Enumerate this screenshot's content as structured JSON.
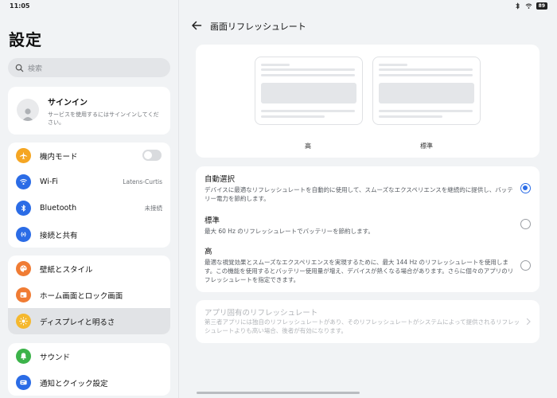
{
  "status_bar": {
    "time": "11:05",
    "battery": "89"
  },
  "left_panel": {
    "title": "設定",
    "search_placeholder": "検索",
    "signin": {
      "title": "サインイン",
      "subtitle": "サービスを使用するにはサインインしてください。"
    },
    "groups": [
      [
        {
          "label": "機内モード",
          "icon": "airplane-icon",
          "color": "#f5a623",
          "toggle": false
        },
        {
          "label": "Wi-Fi",
          "icon": "wifi-icon",
          "color": "#2b6ce6",
          "value": "Latens-Curtis"
        },
        {
          "label": "Bluetooth",
          "icon": "bluetooth-icon",
          "color": "#2b6ce6",
          "value": "未接続"
        },
        {
          "label": "接続と共有",
          "icon": "connection-icon",
          "color": "#2b6ce6"
        }
      ],
      [
        {
          "label": "壁紙とスタイル",
          "icon": "palette-icon",
          "color": "#f07c34"
        },
        {
          "label": "ホーム画面とロック画面",
          "icon": "home-screen-icon",
          "color": "#f07c34"
        },
        {
          "label": "ディスプレイと明るさ",
          "icon": "brightness-icon",
          "color": "#f5b82e",
          "selected": true
        }
      ],
      [
        {
          "label": "サウンド",
          "icon": "bell-icon",
          "color": "#3cb34a"
        },
        {
          "label": "通知とクイック設定",
          "icon": "notification-icon",
          "color": "#2b6ce6"
        }
      ]
    ]
  },
  "right_panel": {
    "title": "画面リフレッシュレート",
    "preview": {
      "high_label": "高",
      "standard_label": "標準"
    },
    "options": [
      {
        "title": "自動選択",
        "desc": "デバイスに最適なリフレッシュレートを自動的に使用して、スムーズなエクスペリエンスを継続的に提供し、バッテリー電力を節約します。",
        "selected": true
      },
      {
        "title": "標準",
        "desc": "最大 60 Hz のリフレッシュレートでバッテリーを節約します。",
        "selected": false
      },
      {
        "title": "高",
        "desc": "最適な視覚効果とスムーズなエクスペリエンスを実現するために、最大 144 Hz のリフレッシュレートを使用します。この機能を使用するとバッテリー使用量が増え、デバイスが熱くなる場合があります。さらに個々のアプリのリフレッシュレートを指定できます。",
        "selected": false
      }
    ],
    "app_specific": {
      "title": "アプリ固有のリフレッシュレート",
      "desc": "第三者アプリには独自のリフレッシュレートがあり、そのリフレッシュレートがシステムによって提供されるリフレッシュレートよりも高い場合、後者が有効になります。"
    }
  },
  "colors": {
    "accent": "#2b6ce6",
    "background": "#f1f3f5",
    "card": "#ffffff"
  }
}
